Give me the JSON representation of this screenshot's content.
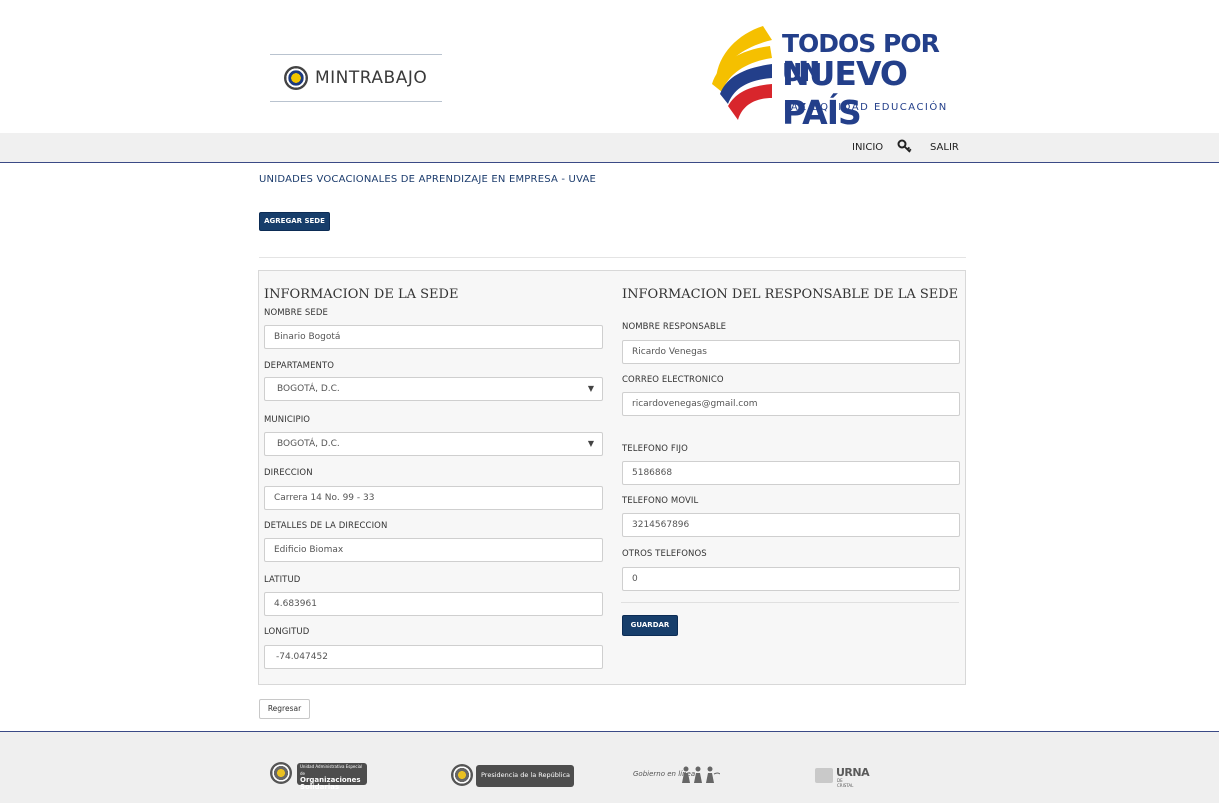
{
  "header": {
    "ministry_name": "MINTRABAJO",
    "campaign_line1": "TODOS POR UN",
    "campaign_line2": "NUEVO PAÍS",
    "campaign_line3": "PAZ  EQUIDAD  EDUCACIÓN"
  },
  "nav": {
    "inicio": "INICIO",
    "salir": "SALIR",
    "key_icon": "key-icon"
  },
  "page": {
    "title": "UNIDADES VOCACIONALES DE APRENDIZAJE EN EMPRESA - UVAE",
    "add_button": "AGREGAR SEDE",
    "back_button": "Regresar"
  },
  "sede": {
    "title": "INFORMACION DE LA SEDE",
    "nombre_label": "NOMBRE SEDE",
    "nombre_value": "Binario Bogotá",
    "departamento_label": "DEPARTAMENTO",
    "departamento_value": "BOGOTÁ, D.C.",
    "municipio_label": "MUNICIPIO",
    "municipio_value": "BOGOTÁ, D.C.",
    "direccion_label": "DIRECCION",
    "direccion_value": "Carrera 14 No. 99 - 33",
    "detalles_label": "DETALLES DE LA DIRECCION",
    "detalles_value": "Edificio Biomax",
    "latitud_label": "LATITUD",
    "latitud_value": "4.683961",
    "longitud_label": "LONGITUD",
    "longitud_value": "-74.047452"
  },
  "responsable": {
    "title": "INFORMACION DEL RESPONSABLE DE LA SEDE",
    "nombre_label": "NOMBRE RESPONSABLE",
    "nombre_value": "Ricardo Venegas",
    "correo_label": "CORREO ELECTRONICO",
    "correo_value": "ricardovenegas@gmail.com",
    "fijo_label": "TELEFONO FIJO",
    "fijo_value": "5186868",
    "movil_label": "TELEFONO MOVIL",
    "movil_value": "3214567896",
    "otros_label": "OTROS TELEFONOS",
    "otros_value": "0",
    "save_button": "GUARDAR"
  },
  "footer": {
    "logo1_line1": "Unidad Administrativa Especial de",
    "logo1_line2": "Organizaciones",
    "logo1_line3": "Solidarias",
    "logo2": "Presidencia de la República",
    "logo3": "Gobierno en línea",
    "logo4_line1": "URNA",
    "logo4_line2": "DE CRISTAL"
  },
  "colors": {
    "primary_button": "#173e6b",
    "nav_border": "#3a4a86",
    "brand_blue": "#233f8a"
  }
}
